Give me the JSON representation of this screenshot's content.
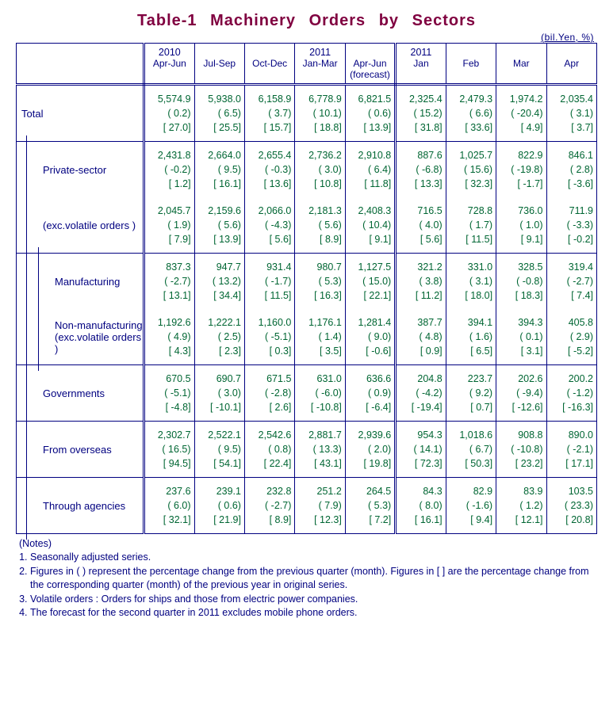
{
  "title": "Table-1  Machinery  Orders  by  Sectors",
  "unit": "(bil.Yen, %)",
  "header": {
    "groups": [
      {
        "top": "2010",
        "sub": "Apr-Jun",
        "note": ""
      },
      {
        "top": "",
        "sub": "Jul-Sep",
        "note": ""
      },
      {
        "top": "",
        "sub": "Oct-Dec",
        "note": ""
      },
      {
        "top": "2011",
        "sub": "Jan-Mar",
        "note": ""
      },
      {
        "top": "",
        "sub": "Apr-Jun",
        "note": "(forecast)"
      },
      {
        "top": "2011",
        "sub": "Jan",
        "note": ""
      },
      {
        "top": "",
        "sub": "Feb",
        "note": ""
      },
      {
        "top": "",
        "sub": "Mar",
        "note": ""
      },
      {
        "top": "",
        "sub": "Apr",
        "note": ""
      }
    ]
  },
  "rows": [
    {
      "key": "total",
      "label": "Total",
      "indent": 0,
      "cells": [
        {
          "v": "5,574.9",
          "p": "( 0.2)",
          "b": "[ 27.0]"
        },
        {
          "v": "5,938.0",
          "p": "( 6.5)",
          "b": "[ 25.5]"
        },
        {
          "v": "6,158.9",
          "p": "( 3.7)",
          "b": "[ 15.7]"
        },
        {
          "v": "6,778.9",
          "p": "( 10.1)",
          "b": "[ 18.8]"
        },
        {
          "v": "6,821.5",
          "p": "( 0.6)",
          "b": "[ 13.9]"
        },
        {
          "v": "2,325.4",
          "p": "( 15.2)",
          "b": "[ 31.8]"
        },
        {
          "v": "2,479.3",
          "p": "( 6.6)",
          "b": "[ 33.6]"
        },
        {
          "v": "1,974.2",
          "p": "( -20.4)",
          "b": "[ 4.9]"
        },
        {
          "v": "2,035.4",
          "p": "( 3.1)",
          "b": "[ 3.7]"
        }
      ]
    },
    {
      "key": "private",
      "label": "Private-sector",
      "indent": 1,
      "nobottom": true,
      "cells": [
        {
          "v": "2,431.8",
          "p": "( -0.2)",
          "b": "[ 1.2]"
        },
        {
          "v": "2,664.0",
          "p": "( 9.5)",
          "b": "[ 16.1]"
        },
        {
          "v": "2,655.4",
          "p": "( -0.3)",
          "b": "[ 13.6]"
        },
        {
          "v": "2,736.2",
          "p": "( 3.0)",
          "b": "[ 10.8]"
        },
        {
          "v": "2,910.8",
          "p": "( 6.4)",
          "b": "[ 11.8]"
        },
        {
          "v": "887.6",
          "p": "( -6.8)",
          "b": "[ 13.3]"
        },
        {
          "v": "1,025.7",
          "p": "( 15.6)",
          "b": "[ 32.3]"
        },
        {
          "v": "822.9",
          "p": "( -19.8)",
          "b": "[ -1.7]"
        },
        {
          "v": "846.1",
          "p": "( 2.8)",
          "b": "[ -3.6]"
        }
      ]
    },
    {
      "key": "private_ex",
      "label": "(exc.volatile orders )",
      "indent": 1,
      "cells": [
        {
          "v": "2,045.7",
          "p": "( 1.9)",
          "b": "[ 7.9]"
        },
        {
          "v": "2,159.6",
          "p": "( 5.6)",
          "b": "[ 13.9]"
        },
        {
          "v": "2,066.0",
          "p": "( -4.3)",
          "b": "[ 5.6]"
        },
        {
          "v": "2,181.3",
          "p": "( 5.6)",
          "b": "[ 8.9]"
        },
        {
          "v": "2,408.3",
          "p": "( 10.4)",
          "b": "[ 9.1]"
        },
        {
          "v": "716.5",
          "p": "( 4.0)",
          "b": "[ 5.6]"
        },
        {
          "v": "728.8",
          "p": "( 1.7)",
          "b": "[ 11.5]"
        },
        {
          "v": "736.0",
          "p": "( 1.0)",
          "b": "[ 9.1]"
        },
        {
          "v": "711.9",
          "p": "( -3.3)",
          "b": "[ -0.2]"
        }
      ]
    },
    {
      "key": "mfg",
      "label": "Manufacturing",
      "indent": 2,
      "nobottom": true,
      "cells": [
        {
          "v": "837.3",
          "p": "( -2.7)",
          "b": "[ 13.1]"
        },
        {
          "v": "947.7",
          "p": "( 13.2)",
          "b": "[ 34.4]"
        },
        {
          "v": "931.4",
          "p": "( -1.7)",
          "b": "[ 11.5]"
        },
        {
          "v": "980.7",
          "p": "( 5.3)",
          "b": "[ 16.3]"
        },
        {
          "v": "1,127.5",
          "p": "( 15.0)",
          "b": "[ 22.1]"
        },
        {
          "v": "321.2",
          "p": "( 3.8)",
          "b": "[ 11.2]"
        },
        {
          "v": "331.0",
          "p": "( 3.1)",
          "b": "[ 18.0]"
        },
        {
          "v": "328.5",
          "p": "( -0.8)",
          "b": "[ 18.3]"
        },
        {
          "v": "319.4",
          "p": "( -2.7)",
          "b": "[ 7.4]"
        }
      ]
    },
    {
      "key": "nonmfg",
      "label": "Non-manufacturing",
      "label2": "(exc.volatile orders )",
      "indent": 2,
      "cells": [
        {
          "v": "1,192.6",
          "p": "( 4.9)",
          "b": "[ 4.3]"
        },
        {
          "v": "1,222.1",
          "p": "( 2.5)",
          "b": "[ 2.3]"
        },
        {
          "v": "1,160.0",
          "p": "( -5.1)",
          "b": "[ 0.3]"
        },
        {
          "v": "1,176.1",
          "p": "( 1.4)",
          "b": "[ 3.5]"
        },
        {
          "v": "1,281.4",
          "p": "( 9.0)",
          "b": "[ -0.6]"
        },
        {
          "v": "387.7",
          "p": "( 4.8)",
          "b": "[ 0.9]"
        },
        {
          "v": "394.1",
          "p": "( 1.6)",
          "b": "[ 6.5]"
        },
        {
          "v": "394.3",
          "p": "( 0.1)",
          "b": "[ 3.1]"
        },
        {
          "v": "405.8",
          "p": "( 2.9)",
          "b": "[ -5.2]"
        }
      ]
    },
    {
      "key": "gov",
      "label": "Governments",
      "indent": 1,
      "cells": [
        {
          "v": "670.5",
          "p": "( -5.1)",
          "b": "[ -4.8]"
        },
        {
          "v": "690.7",
          "p": "( 3.0)",
          "b": "[ -10.1]"
        },
        {
          "v": "671.5",
          "p": "( -2.8)",
          "b": "[ 2.6]"
        },
        {
          "v": "631.0",
          "p": "( -6.0)",
          "b": "[ -10.8]"
        },
        {
          "v": "636.6",
          "p": "( 0.9)",
          "b": "[ -6.4]"
        },
        {
          "v": "204.8",
          "p": "( -4.2)",
          "b": "[ -19.4]"
        },
        {
          "v": "223.7",
          "p": "( 9.2)",
          "b": "[ 0.7]"
        },
        {
          "v": "202.6",
          "p": "( -9.4)",
          "b": "[ -12.6]"
        },
        {
          "v": "200.2",
          "p": "( -1.2)",
          "b": "[ -16.3]"
        }
      ]
    },
    {
      "key": "overseas",
      "label": "From overseas",
      "indent": 1,
      "cells": [
        {
          "v": "2,302.7",
          "p": "( 16.5)",
          "b": "[ 94.5]"
        },
        {
          "v": "2,522.1",
          "p": "( 9.5)",
          "b": "[ 54.1]"
        },
        {
          "v": "2,542.6",
          "p": "( 0.8)",
          "b": "[ 22.4]"
        },
        {
          "v": "2,881.7",
          "p": "( 13.3)",
          "b": "[ 43.1]"
        },
        {
          "v": "2,939.6",
          "p": "( 2.0)",
          "b": "[ 19.8]"
        },
        {
          "v": "954.3",
          "p": "( 14.1)",
          "b": "[ 72.3]"
        },
        {
          "v": "1,018.6",
          "p": "( 6.7)",
          "b": "[ 50.3]"
        },
        {
          "v": "908.8",
          "p": "( -10.8)",
          "b": "[ 23.2]"
        },
        {
          "v": "890.0",
          "p": "( -2.1)",
          "b": "[ 17.1]"
        }
      ]
    },
    {
      "key": "agencies",
      "label": "Through agencies",
      "indent": 1,
      "cells": [
        {
          "v": "237.6",
          "p": "( 6.0)",
          "b": "[ 32.1]"
        },
        {
          "v": "239.1",
          "p": "( 0.6)",
          "b": "[ 21.9]"
        },
        {
          "v": "232.8",
          "p": "( -2.7)",
          "b": "[ 8.9]"
        },
        {
          "v": "251.2",
          "p": "( 7.9)",
          "b": "[ 12.3]"
        },
        {
          "v": "264.5",
          "p": "( 5.3)",
          "b": "[ 7.2]"
        },
        {
          "v": "84.3",
          "p": "( 8.0)",
          "b": "[ 16.1]"
        },
        {
          "v": "82.9",
          "p": "( -1.6)",
          "b": "[ 9.4]"
        },
        {
          "v": "83.9",
          "p": "( 1.2)",
          "b": "[ 12.1]"
        },
        {
          "v": "103.5",
          "p": "( 23.3)",
          "b": "[ 20.8]"
        }
      ]
    }
  ],
  "notes": {
    "header": "(Notes)",
    "items": [
      "Seasonally adjusted series.",
      "Figures in ( ) represent the percentage change from the previous quarter (month). Figures in [ ] are the percentage change from the corresponding quarter (month) of the previous year in original series.",
      "Volatile orders : Orders for ships and those from electric power companies.",
      "The forecast for the second quarter in 2011 excludes mobile phone orders."
    ]
  },
  "chart_data": {
    "type": "table",
    "title": "Table-1 Machinery Orders by Sectors",
    "unit": "bil.Yen, %",
    "columns": [
      "2010 Apr-Jun",
      "2010 Jul-Sep",
      "2010 Oct-Dec",
      "2011 Jan-Mar",
      "2011 Apr-Jun (forecast)",
      "2011 Jan",
      "2011 Feb",
      "2011 Mar",
      "2011 Apr"
    ],
    "series": [
      {
        "name": "Total",
        "values": [
          5574.9,
          5938.0,
          6158.9,
          6778.9,
          6821.5,
          2325.4,
          2479.3,
          1974.2,
          2035.4
        ],
        "pct_prev": [
          0.2,
          6.5,
          3.7,
          10.1,
          0.6,
          15.2,
          6.6,
          -20.4,
          3.1
        ],
        "pct_yoy": [
          27.0,
          25.5,
          15.7,
          18.8,
          13.9,
          31.8,
          33.6,
          4.9,
          3.7
        ]
      },
      {
        "name": "Private-sector",
        "values": [
          2431.8,
          2664.0,
          2655.4,
          2736.2,
          2910.8,
          887.6,
          1025.7,
          822.9,
          846.1
        ],
        "pct_prev": [
          -0.2,
          9.5,
          -0.3,
          3.0,
          6.4,
          -6.8,
          15.6,
          -19.8,
          2.8
        ],
        "pct_yoy": [
          1.2,
          16.1,
          13.6,
          10.8,
          11.8,
          13.3,
          32.3,
          -1.7,
          -3.6
        ]
      },
      {
        "name": "Private-sector (exc.volatile orders)",
        "values": [
          2045.7,
          2159.6,
          2066.0,
          2181.3,
          2408.3,
          716.5,
          728.8,
          736.0,
          711.9
        ],
        "pct_prev": [
          1.9,
          5.6,
          -4.3,
          5.6,
          10.4,
          4.0,
          1.7,
          1.0,
          -3.3
        ],
        "pct_yoy": [
          7.9,
          13.9,
          5.6,
          8.9,
          9.1,
          5.6,
          11.5,
          9.1,
          -0.2
        ]
      },
      {
        "name": "Manufacturing",
        "values": [
          837.3,
          947.7,
          931.4,
          980.7,
          1127.5,
          321.2,
          331.0,
          328.5,
          319.4
        ],
        "pct_prev": [
          -2.7,
          13.2,
          -1.7,
          5.3,
          15.0,
          3.8,
          3.1,
          -0.8,
          -2.7
        ],
        "pct_yoy": [
          13.1,
          34.4,
          11.5,
          16.3,
          22.1,
          11.2,
          18.0,
          18.3,
          7.4
        ]
      },
      {
        "name": "Non-manufacturing (exc.volatile orders)",
        "values": [
          1192.6,
          1222.1,
          1160.0,
          1176.1,
          1281.4,
          387.7,
          394.1,
          394.3,
          405.8
        ],
        "pct_prev": [
          4.9,
          2.5,
          -5.1,
          1.4,
          9.0,
          4.8,
          1.6,
          0.1,
          2.9
        ],
        "pct_yoy": [
          4.3,
          2.3,
          0.3,
          3.5,
          -0.6,
          0.9,
          6.5,
          3.1,
          -5.2
        ]
      },
      {
        "name": "Governments",
        "values": [
          670.5,
          690.7,
          671.5,
          631.0,
          636.6,
          204.8,
          223.7,
          202.6,
          200.2
        ],
        "pct_prev": [
          -5.1,
          3.0,
          -2.8,
          -6.0,
          0.9,
          -4.2,
          9.2,
          -9.4,
          -1.2
        ],
        "pct_yoy": [
          -4.8,
          -10.1,
          2.6,
          -10.8,
          -6.4,
          -19.4,
          0.7,
          -12.6,
          -16.3
        ]
      },
      {
        "name": "From overseas",
        "values": [
          2302.7,
          2522.1,
          2542.6,
          2881.7,
          2939.6,
          954.3,
          1018.6,
          908.8,
          890.0
        ],
        "pct_prev": [
          16.5,
          9.5,
          0.8,
          13.3,
          2.0,
          14.1,
          6.7,
          -10.8,
          -2.1
        ],
        "pct_yoy": [
          94.5,
          54.1,
          22.4,
          43.1,
          19.8,
          72.3,
          50.3,
          23.2,
          17.1
        ]
      },
      {
        "name": "Through agencies",
        "values": [
          237.6,
          239.1,
          232.8,
          251.2,
          264.5,
          84.3,
          82.9,
          83.9,
          103.5
        ],
        "pct_prev": [
          6.0,
          0.6,
          -2.7,
          7.9,
          5.3,
          8.0,
          -1.6,
          1.2,
          23.3
        ],
        "pct_yoy": [
          32.1,
          21.9,
          8.9,
          12.3,
          7.2,
          16.1,
          9.4,
          12.1,
          20.8
        ]
      }
    ]
  }
}
